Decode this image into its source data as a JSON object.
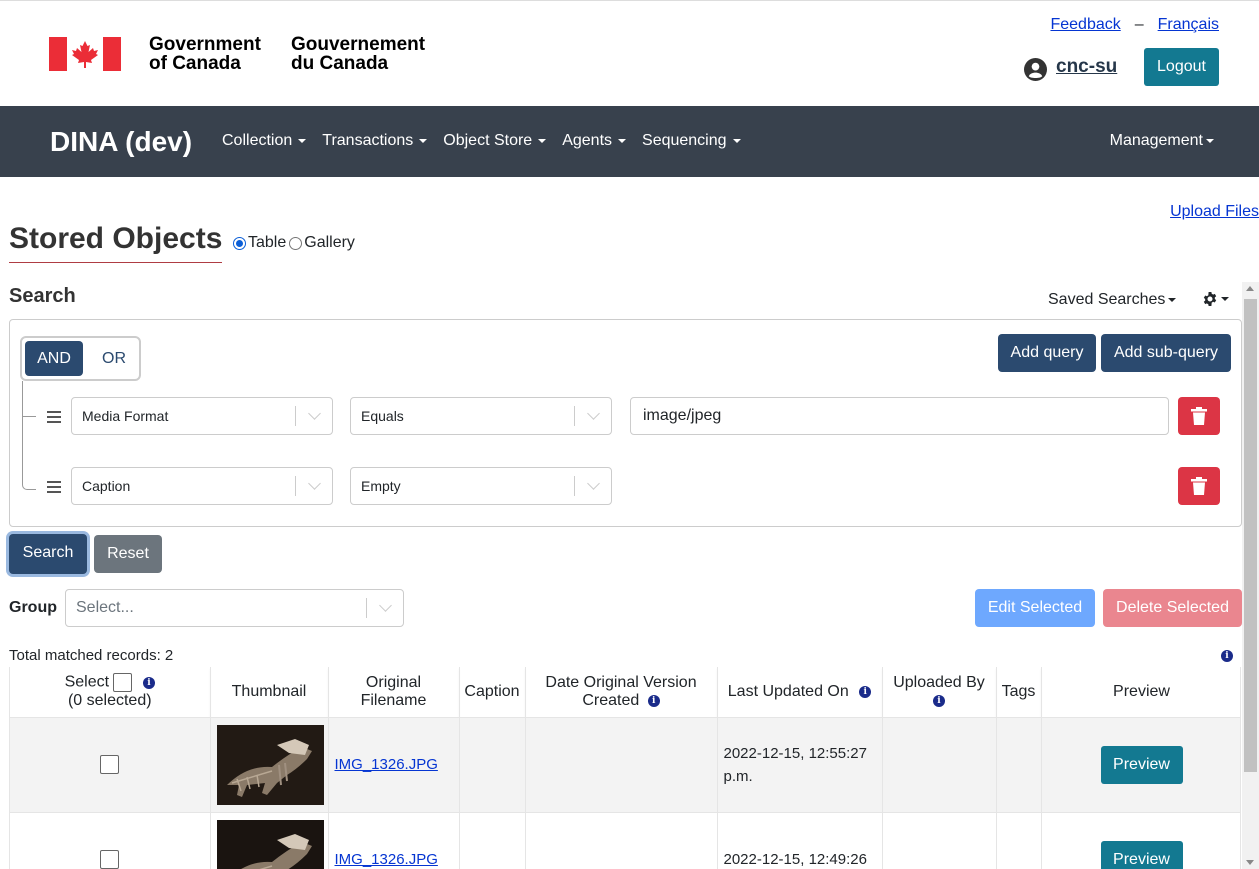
{
  "gov": {
    "name_en_line1": "Government",
    "name_en_line2": "of Canada",
    "name_fr_line1": "Gouvernement",
    "name_fr_line2": "du Canada",
    "feedback": "Feedback",
    "separator": "–",
    "francais": "Français",
    "username": "cnc-su",
    "logout": "Logout",
    "flag_red": "#eb2d37"
  },
  "nav": {
    "brand": "DINA (dev)",
    "items": [
      "Collection",
      "Transactions",
      "Object Store",
      "Agents",
      "Sequencing"
    ],
    "management": "Management"
  },
  "page": {
    "upload_files": "Upload Files",
    "title": "Stored Objects",
    "view_table": "Table",
    "view_gallery": "Gallery",
    "view_selected": "Table"
  },
  "search": {
    "title": "Search",
    "saved_searches": "Saved Searches",
    "and": "AND",
    "or": "OR",
    "add_query": "Add query",
    "add_sub_query": "Add sub-query",
    "rows": [
      {
        "field": "Media Format",
        "operator": "Equals",
        "value": "image/jpeg"
      },
      {
        "field": "Caption",
        "operator": "Empty",
        "value": ""
      }
    ],
    "search_button": "Search",
    "reset_button": "Reset"
  },
  "group": {
    "label": "Group",
    "placeholder": "Select...",
    "edit_selected": "Edit Selected",
    "delete_selected": "Delete Selected"
  },
  "results": {
    "total_text": "Total matched records: 2",
    "columns": {
      "select": "Select",
      "selected_count": "(0 selected)",
      "thumbnail": "Thumbnail",
      "original_filename_1": "Original",
      "original_filename_2": "Filename",
      "caption": "Caption",
      "date_created_1": "Date Original Version",
      "date_created_2": "Created",
      "last_updated": "Last Updated On",
      "uploaded_by": "Uploaded By",
      "tags": "Tags",
      "preview": "Preview"
    },
    "rows": [
      {
        "filename": "IMG_1326.JPG",
        "caption": "",
        "date_created": "",
        "last_updated": "2022-12-15, 12:55:27 p.m.",
        "uploaded_by": "",
        "tags": "",
        "preview": "Preview"
      },
      {
        "filename": "IMG_1326.JPG",
        "caption": "",
        "date_created": "",
        "last_updated": "2022-12-15, 12:49:26",
        "uploaded_by": "",
        "tags": "",
        "preview": "Preview"
      }
    ]
  }
}
